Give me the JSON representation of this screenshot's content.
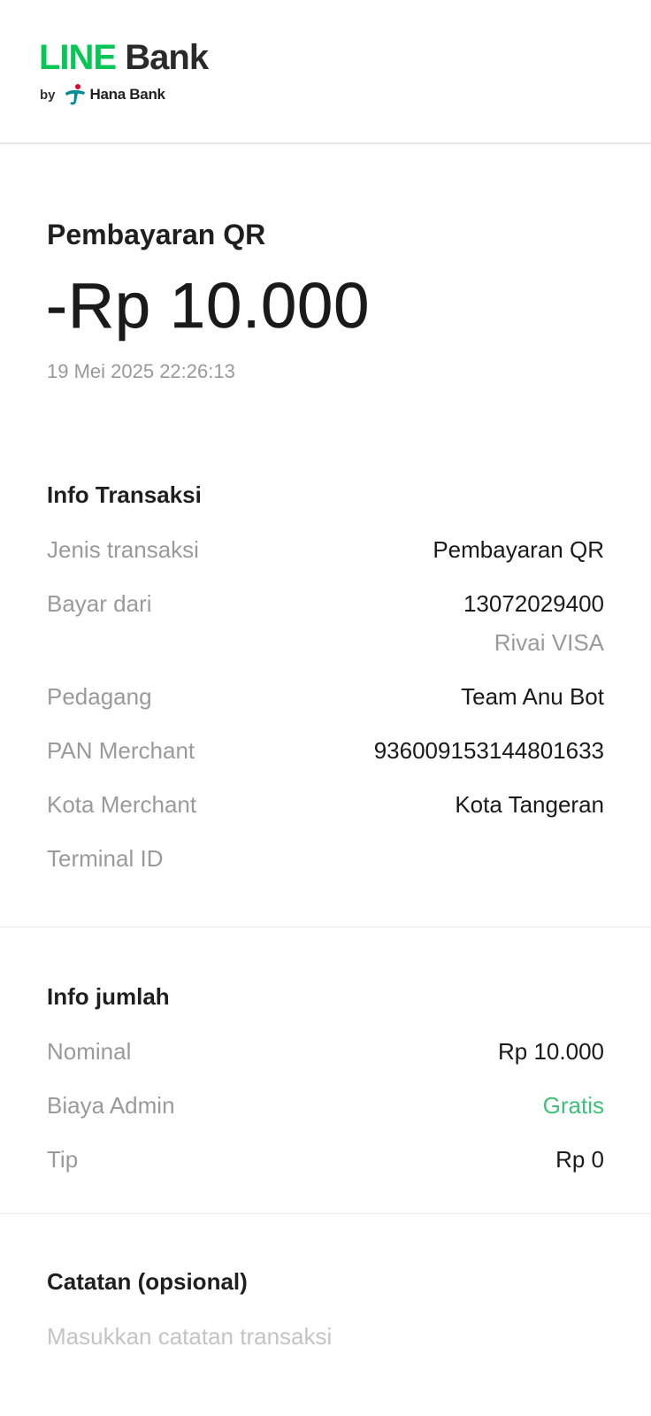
{
  "header": {
    "logo_line": "LINE",
    "logo_bank": "Bank",
    "logo_by": "by",
    "logo_hana": "Hana Bank",
    "colors": {
      "line_green": "#06c755",
      "hana_teal": "#008c95",
      "hana_red": "#e4002b"
    }
  },
  "summary": {
    "title": "Pembayaran QR",
    "amount": "-Rp 10.000",
    "datetime": "19 Mei 2025 22:26:13"
  },
  "transaction_info": {
    "title": "Info Transaksi",
    "rows": [
      {
        "label": "Jenis transaksi",
        "value": "Pembayaran QR"
      },
      {
        "label": "Bayar dari",
        "value": "13072029400",
        "sub": "Rivai VISA"
      },
      {
        "label": "Pedagang",
        "value": "Team Anu Bot"
      },
      {
        "label": "PAN Merchant",
        "value": "936009153144801633"
      },
      {
        "label": "Kota Merchant",
        "value": "Kota Tangeran"
      },
      {
        "label": "Terminal ID",
        "value": ""
      }
    ]
  },
  "amount_info": {
    "title": "Info jumlah",
    "rows": [
      {
        "label": "Nominal",
        "value": "Rp 10.000"
      },
      {
        "label": "Biaya Admin",
        "value": "Gratis",
        "value_color": "#3ec27a"
      },
      {
        "label": "Tip",
        "value": "Rp 0"
      }
    ]
  },
  "notes": {
    "title": "Catatan (opsional)",
    "placeholder": "Masukkan catatan transaksi",
    "value": ""
  }
}
